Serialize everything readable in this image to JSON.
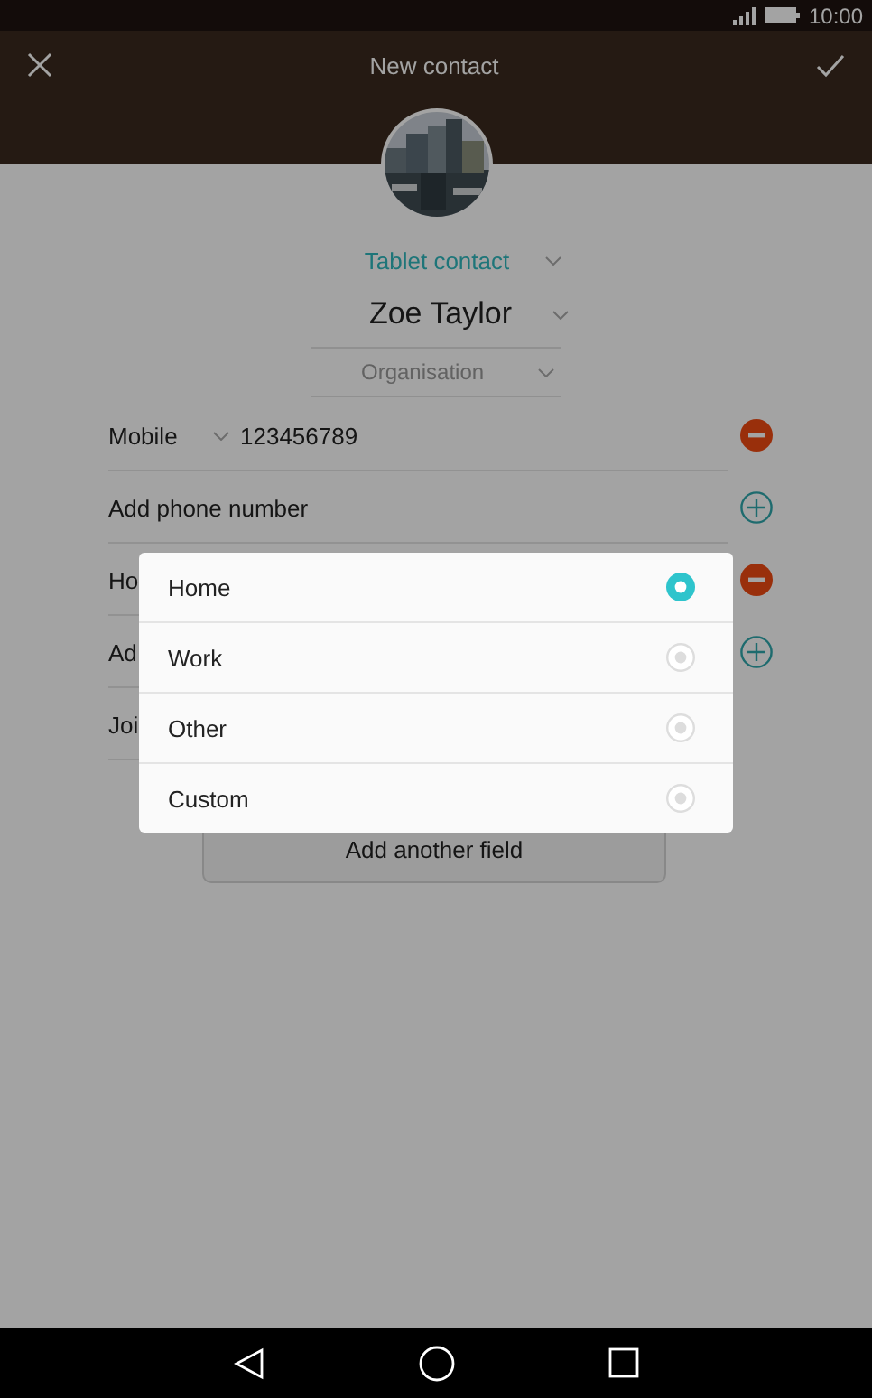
{
  "status_bar": {
    "time": "10:00"
  },
  "header": {
    "title": "New contact"
  },
  "account": {
    "label": "Tablet contact"
  },
  "name_field": {
    "value": "Zoe Taylor"
  },
  "organisation_field": {
    "placeholder": "Organisation"
  },
  "fields": [
    {
      "kind": "phone",
      "type_label": "Mobile",
      "value": "123456789",
      "button": {
        "kind": "remove"
      }
    },
    {
      "kind": "add",
      "label": "Add phone number",
      "button": {
        "kind": "add"
      }
    },
    {
      "kind": "add",
      "label": "Ho",
      "button": {
        "kind": "remove"
      }
    },
    {
      "kind": "add",
      "label": "Ad",
      "button": {
        "kind": "add"
      }
    },
    {
      "kind": "add",
      "label": "Joi"
    }
  ],
  "add_field_button": {
    "label": "Add another field"
  },
  "dialog": {
    "options": [
      {
        "label": "Home",
        "selected": true
      },
      {
        "label": "Work",
        "selected": false
      },
      {
        "label": "Other",
        "selected": false
      },
      {
        "label": "Custom",
        "selected": false
      }
    ]
  }
}
